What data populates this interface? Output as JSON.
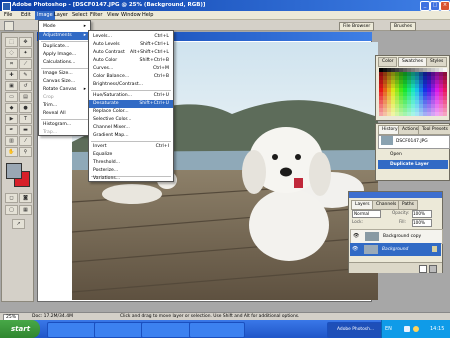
{
  "window_title": "Adobe Photoshop - [DSCF0147.JPG @ 25% (Background, RGB)]",
  "menubar": [
    "File",
    "Edit",
    "Image",
    "Layer",
    "Select",
    "Filter",
    "View",
    "Window",
    "Help"
  ],
  "selected_menu": "Image",
  "options": {
    "browser": "File Browser",
    "brushes": "Brushes"
  },
  "image_menu": [
    {
      "label": "Mode",
      "shortcut": ""
    },
    {
      "label": "Adjustments",
      "shortcut": ""
    },
    {
      "label": "Duplicate...",
      "shortcut": ""
    },
    {
      "label": "Apply Image...",
      "shortcut": ""
    },
    {
      "label": "Calculations...",
      "shortcut": ""
    },
    {
      "label": "Image Size...",
      "shortcut": ""
    },
    {
      "label": "Canvas Size...",
      "shortcut": ""
    },
    {
      "label": "Rotate Canvas",
      "shortcut": ""
    },
    {
      "label": "Crop",
      "shortcut": ""
    },
    {
      "label": "Trim...",
      "shortcut": ""
    },
    {
      "label": "Reveal All",
      "shortcut": ""
    },
    {
      "label": "Histogram...",
      "shortcut": ""
    },
    {
      "label": "Trap...",
      "shortcut": ""
    }
  ],
  "adjustments_menu": [
    {
      "label": "Levels...",
      "shortcut": "Ctrl+L"
    },
    {
      "label": "Auto Levels",
      "shortcut": "Shift+Ctrl+L"
    },
    {
      "label": "Auto Contrast",
      "shortcut": "Alt+Shift+Ctrl+L"
    },
    {
      "label": "Auto Color",
      "shortcut": "Shift+Ctrl+B"
    },
    {
      "label": "Curves...",
      "shortcut": "Ctrl+M"
    },
    {
      "label": "Color Balance...",
      "shortcut": "Ctrl+B"
    },
    {
      "label": "Brightness/Contrast...",
      "shortcut": ""
    },
    {
      "label": "Hue/Saturation...",
      "shortcut": "Ctrl+U"
    },
    {
      "label": "Desaturate",
      "shortcut": "Shift+Ctrl+U"
    },
    {
      "label": "Replace Color...",
      "shortcut": ""
    },
    {
      "label": "Selective Color...",
      "shortcut": ""
    },
    {
      "label": "Channel Mixer...",
      "shortcut": ""
    },
    {
      "label": "Gradient Map...",
      "shortcut": ""
    },
    {
      "label": "Invert",
      "shortcut": "Ctrl+I"
    },
    {
      "label": "Equalize",
      "shortcut": ""
    },
    {
      "label": "Threshold...",
      "shortcut": ""
    },
    {
      "label": "Posterize...",
      "shortcut": ""
    },
    {
      "label": "Variations...",
      "shortcut": ""
    }
  ],
  "swatches_panel": {
    "tabs": [
      "Color",
      "Swatches",
      "Styles"
    ]
  },
  "history_panel": {
    "tabs": [
      "History",
      "Actions",
      "Tool Presets"
    ],
    "items": [
      "DSCF0147.JPG",
      "Open",
      "Duplicate Layer"
    ]
  },
  "layers_panel": {
    "tabs": [
      "Layers",
      "Channels",
      "Paths"
    ],
    "blend": "Normal",
    "opacity_label": "Opacity:",
    "opacity": "100%",
    "lock_label": "Lock:",
    "fill_label": "Fill:",
    "fill": "100%",
    "layers": [
      "Background copy",
      "Background"
    ]
  },
  "statusbar": {
    "zoom": "25%",
    "doc": "Doc: 17.2M/34.4M",
    "hint": "Click and drag to move layer or selection. Use Shift and Alt for additional options."
  },
  "taskbar": {
    "start": "start",
    "tasks": [
      "",
      "",
      "",
      "",
      "Adobe Photosh..."
    ],
    "lang": "EN",
    "time": "14:15"
  }
}
